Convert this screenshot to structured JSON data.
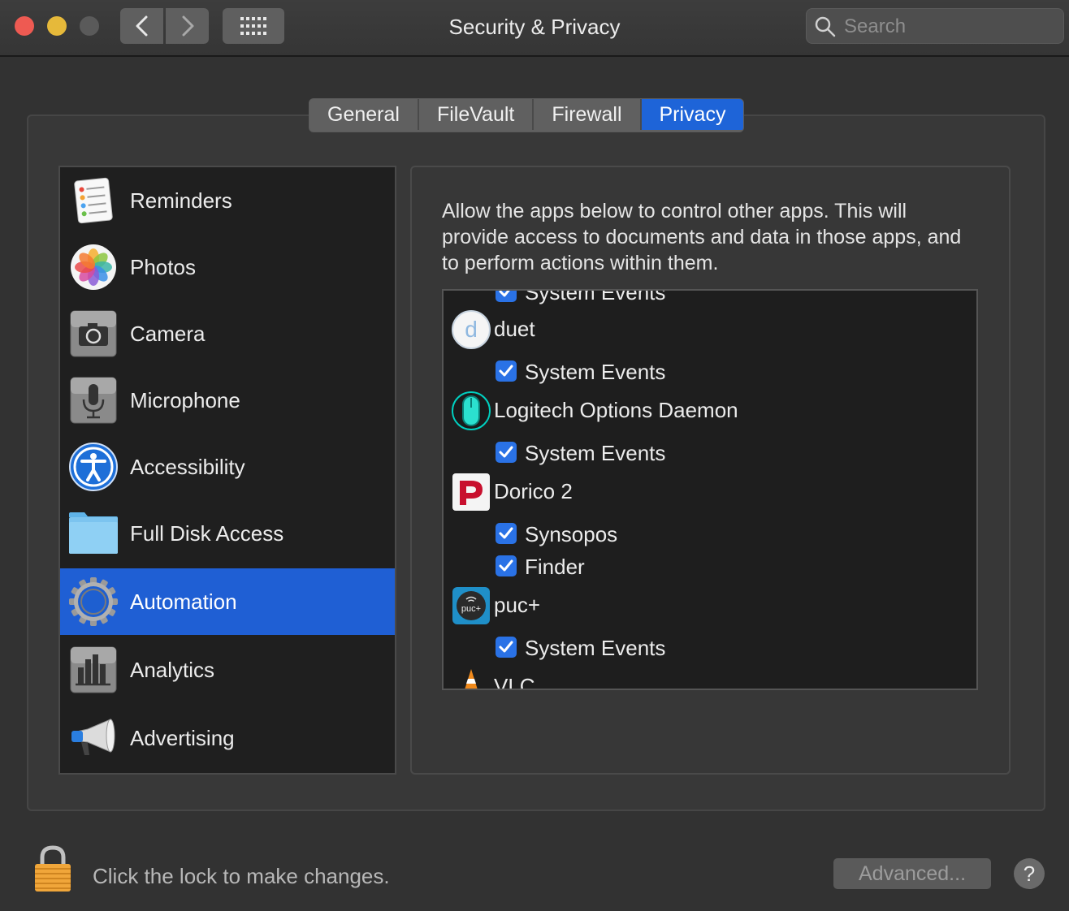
{
  "window": {
    "title": "Security & Privacy",
    "search_placeholder": "Search"
  },
  "tabs": [
    {
      "label": "General"
    },
    {
      "label": "FileVault"
    },
    {
      "label": "Firewall"
    },
    {
      "label": "Privacy",
      "active": true
    }
  ],
  "sidebar": {
    "items": [
      {
        "label": "Reminders",
        "icon": "reminders-icon"
      },
      {
        "label": "Photos",
        "icon": "photos-icon"
      },
      {
        "label": "Camera",
        "icon": "camera-icon"
      },
      {
        "label": "Microphone",
        "icon": "microphone-icon"
      },
      {
        "label": "Accessibility",
        "icon": "accessibility-icon"
      },
      {
        "label": "Full Disk Access",
        "icon": "folder-icon"
      },
      {
        "label": "Automation",
        "icon": "gear-icon",
        "selected": true
      },
      {
        "label": "Analytics",
        "icon": "analytics-icon"
      },
      {
        "label": "Advertising",
        "icon": "megaphone-icon"
      }
    ]
  },
  "content": {
    "description": "Allow the apps below to control other apps. This will provide access to documents and data in those apps, and to perform actions within them.",
    "partial_top_label": "System Events",
    "apps": [
      {
        "name": "duet",
        "icon": "duet-icon",
        "targets": [
          {
            "label": "System Events",
            "checked": true
          }
        ]
      },
      {
        "name": "Logitech Options Daemon",
        "icon": "logitech-mouse-icon",
        "targets": [
          {
            "label": "System Events",
            "checked": true
          }
        ]
      },
      {
        "name": "Dorico 2",
        "icon": "dorico-icon",
        "targets": [
          {
            "label": "Synsopos",
            "checked": true
          },
          {
            "label": "Finder",
            "checked": true
          }
        ]
      },
      {
        "name": "puc+",
        "icon": "puc-icon",
        "targets": [
          {
            "label": "System Events",
            "checked": true
          }
        ]
      },
      {
        "name": "VLC",
        "icon": "vlc-cone-icon",
        "targets": []
      }
    ]
  },
  "footer": {
    "lock_text": "Click the lock to make changes.",
    "advanced_label": "Advanced...",
    "help_label": "?"
  },
  "colors": {
    "accent": "#1f5fd4",
    "checkbox": "#2a72e6",
    "background": "#323232"
  }
}
